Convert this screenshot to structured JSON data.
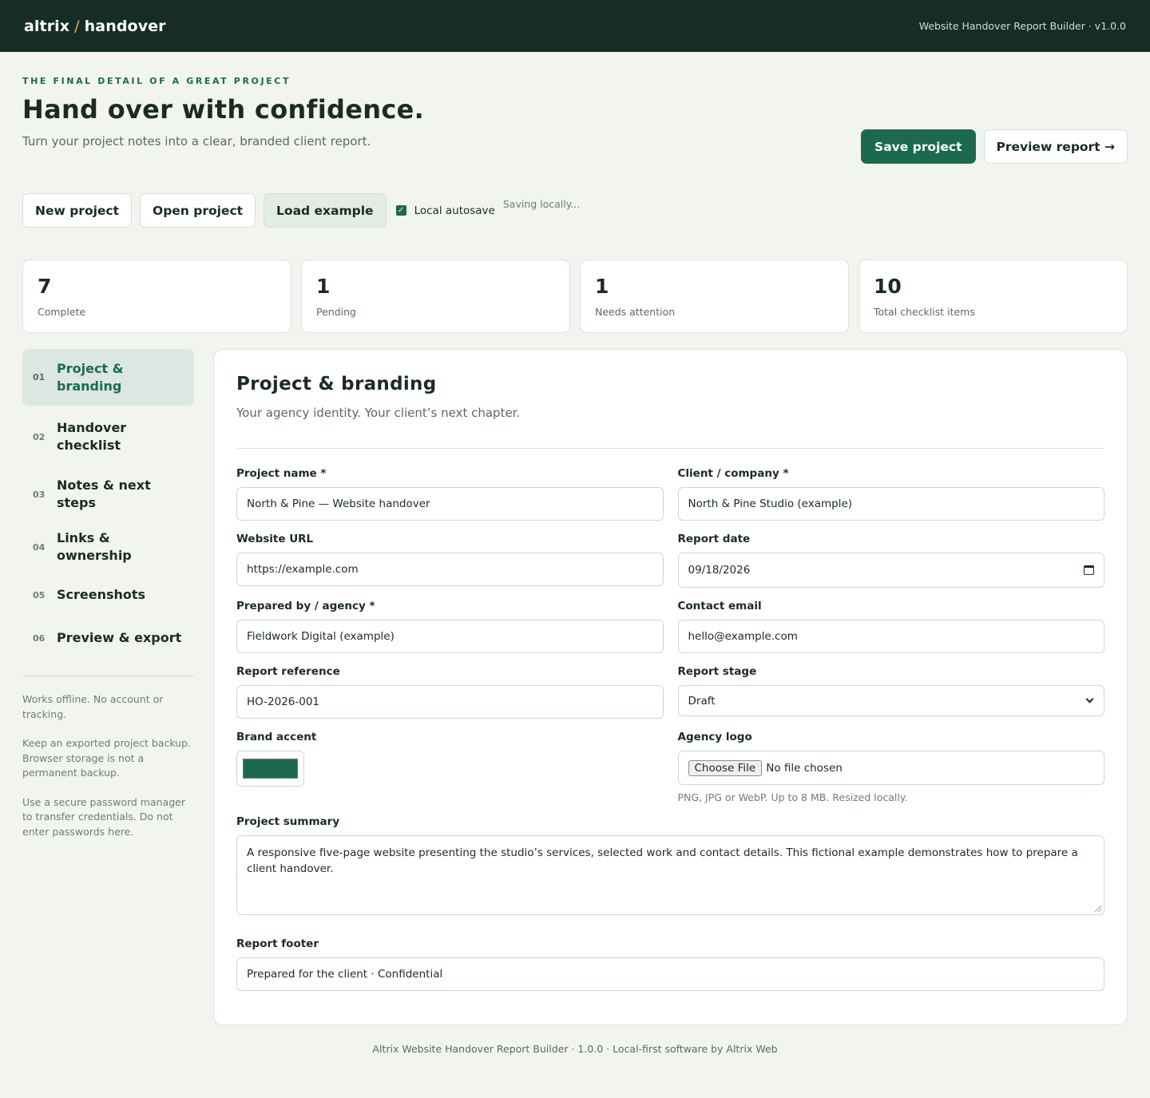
{
  "topbar": {
    "brand_left": "altrix",
    "brand_slash": "/",
    "brand_right": "handover",
    "meta": "Website Handover Report Builder · v1.0.0"
  },
  "hero": {
    "eyebrow": "THE FINAL DETAIL OF A GREAT PROJECT",
    "title": "Hand over with confidence.",
    "subtitle": "Turn your project notes into a clear, branded client report.",
    "save_label": "Save project",
    "preview_label": "Preview report →"
  },
  "toolbar": {
    "new_label": "New project",
    "open_label": "Open project",
    "example_label": "Load example",
    "autosave_label": "Local autosave",
    "autosave_checked": true,
    "status": "Saving locally..."
  },
  "stats": [
    {
      "value": "7",
      "label": "Complete"
    },
    {
      "value": "1",
      "label": "Pending"
    },
    {
      "value": "1",
      "label": "Needs attention"
    },
    {
      "value": "10",
      "label": "Total checklist items"
    }
  ],
  "sidebar": {
    "items": [
      {
        "num": "01",
        "label": "Project & branding",
        "active": true
      },
      {
        "num": "02",
        "label": "Handover checklist"
      },
      {
        "num": "03",
        "label": "Notes & next steps"
      },
      {
        "num": "04",
        "label": "Links & ownership"
      },
      {
        "num": "05",
        "label": "Screenshots"
      },
      {
        "num": "06",
        "label": "Preview & export"
      }
    ],
    "notes": [
      "Works offline. No account or tracking.",
      "Keep an exported project backup. Browser storage is not a permanent backup.",
      "Use a secure password manager to transfer credentials. Do not enter passwords here."
    ]
  },
  "panel": {
    "title": "Project & branding",
    "subtitle": "Your agency identity. Your client’s next chapter.",
    "fields": {
      "project_name": {
        "label": "Project name *",
        "value": "North & Pine — Website handover"
      },
      "client": {
        "label": "Client / company *",
        "value": "North & Pine Studio (example)"
      },
      "website_url": {
        "label": "Website URL",
        "value": "https://example.com"
      },
      "report_date": {
        "label": "Report date",
        "value": "09/18/2026"
      },
      "prepared_by": {
        "label": "Prepared by / agency *",
        "value": "Fieldwork Digital (example)"
      },
      "contact_email": {
        "label": "Contact email",
        "value": "hello@example.com"
      },
      "report_reference": {
        "label": "Report reference",
        "value": "HO-2026-001"
      },
      "report_stage": {
        "label": "Report stage",
        "value": "Draft"
      },
      "brand_accent": {
        "label": "Brand accent",
        "color": "#1b6a4e"
      },
      "agency_logo": {
        "label": "Agency logo",
        "button": "Choose File",
        "value": "No file chosen",
        "hint": "PNG, JPG or WebP. Up to 8 MB. Resized locally."
      },
      "project_summary": {
        "label": "Project summary",
        "value": "A responsive five-page website presenting the studio’s services, selected work and contact details. This fictional example demonstrates how to prepare a client handover."
      },
      "report_footer": {
        "label": "Report footer",
        "value": "Prepared for the client · Confidential"
      }
    }
  },
  "footer": {
    "text": "Altrix Website Handover Report Builder · 1.0.0 · Local-first software by Altrix Web"
  },
  "colors": {
    "topbar": "#162c25",
    "accent": "#1b6a4e",
    "brand_slash": "#e3b64a",
    "background": "#f2f4ef"
  }
}
